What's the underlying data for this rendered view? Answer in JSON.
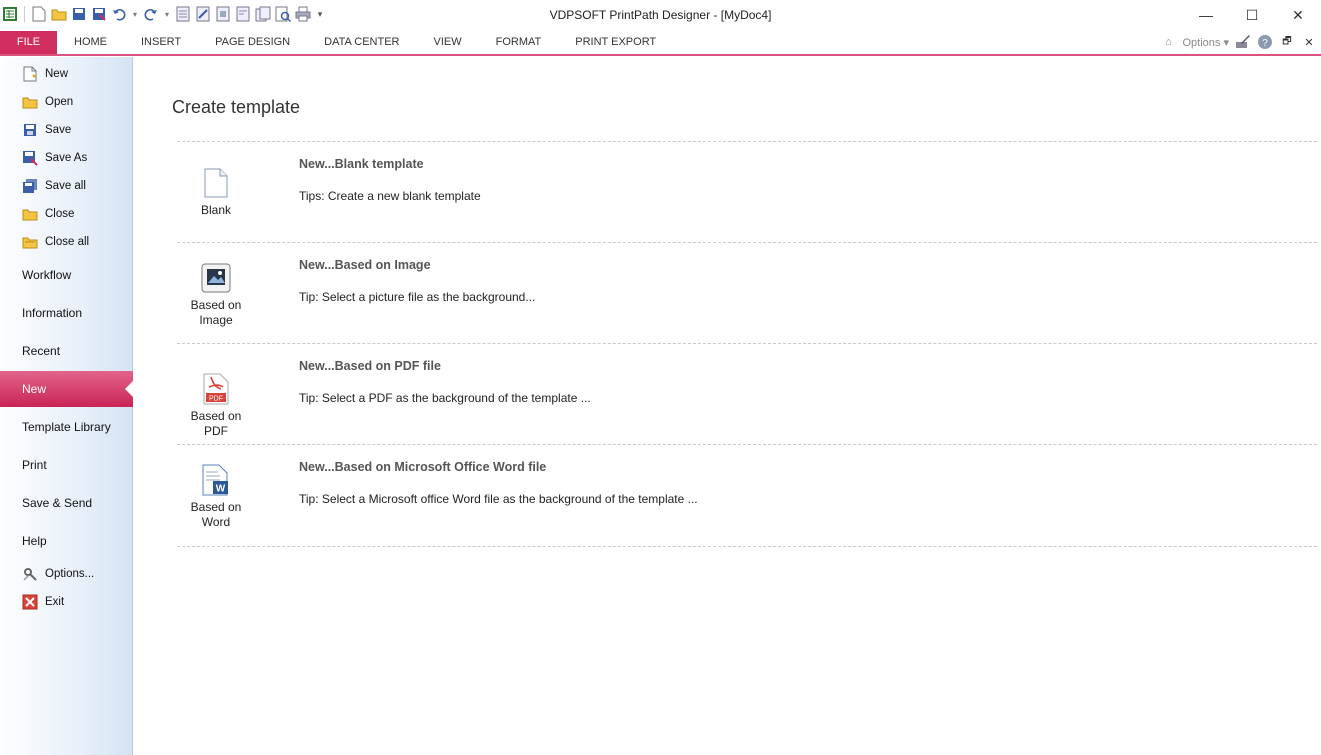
{
  "window": {
    "title": "VDPSOFT PrintPath Designer - [MyDoc4]",
    "controls": {
      "minimize": "—",
      "maximize": "☐",
      "close": "✕"
    }
  },
  "quick_access": [
    "app-icon",
    "new-icon",
    "open-icon",
    "save-icon",
    "save-as-icon",
    "undo-icon",
    "redo-icon",
    "page-icon",
    "page-icon",
    "page-icon",
    "page-icon",
    "page-icon",
    "preview-icon",
    "print-icon",
    "customize-icon"
  ],
  "ribbon": {
    "tabs": [
      "FILE",
      "HOME",
      "INSERT",
      "PAGE DESIGN",
      "DATA CENTER",
      "VIEW",
      "FORMAT",
      "PRINT EXPORT"
    ],
    "options_label": "Options",
    "right_glyphs": {
      "collapse": "⌂",
      "dropdown": "▾",
      "help": "?",
      "restore": "🗗",
      "close": "✕"
    }
  },
  "sidebar": {
    "file_items": [
      {
        "label": "New",
        "icon": "new-file-icon"
      },
      {
        "label": "Open",
        "icon": "open-folder-icon"
      },
      {
        "label": "Save",
        "icon": "save-icon"
      },
      {
        "label": "Save As",
        "icon": "save-as-icon"
      },
      {
        "label": "Save all",
        "icon": "save-all-icon"
      },
      {
        "label": "Close",
        "icon": "close-folder-icon"
      },
      {
        "label": "Close all",
        "icon": "close-all-folder-icon"
      }
    ],
    "sections": [
      "Workflow",
      "Information",
      "Recent",
      "New",
      "Template Library",
      "Print",
      "Save & Send",
      "Help"
    ],
    "active_section": "New",
    "bottom_items": [
      {
        "label": "Options...",
        "icon": "options-icon"
      },
      {
        "label": "Exit",
        "icon": "exit-icon"
      }
    ]
  },
  "main": {
    "heading": "Create template",
    "templates": [
      {
        "caption": "Blank",
        "title": "New...Blank template",
        "tip": "Tips: Create a new blank template",
        "icon": "blank-document-icon"
      },
      {
        "caption": "Based on Image",
        "title": "New...Based on Image",
        "tip": "Tip: Select a picture file as the background...",
        "icon": "image-icon"
      },
      {
        "caption": "Based on PDF",
        "title": "New...Based on PDF file",
        "tip": "Tip: Select a PDF as the background of the template ...",
        "icon": "pdf-icon"
      },
      {
        "caption": "Based on Word",
        "title": "New...Based on Microsoft Office Word file",
        "tip": "Tip: Select a Microsoft office Word file as the background of the template ...",
        "icon": "word-icon"
      }
    ]
  },
  "colors": {
    "accent": "#d12e60",
    "sidebar_end": "#d6e3f4"
  }
}
